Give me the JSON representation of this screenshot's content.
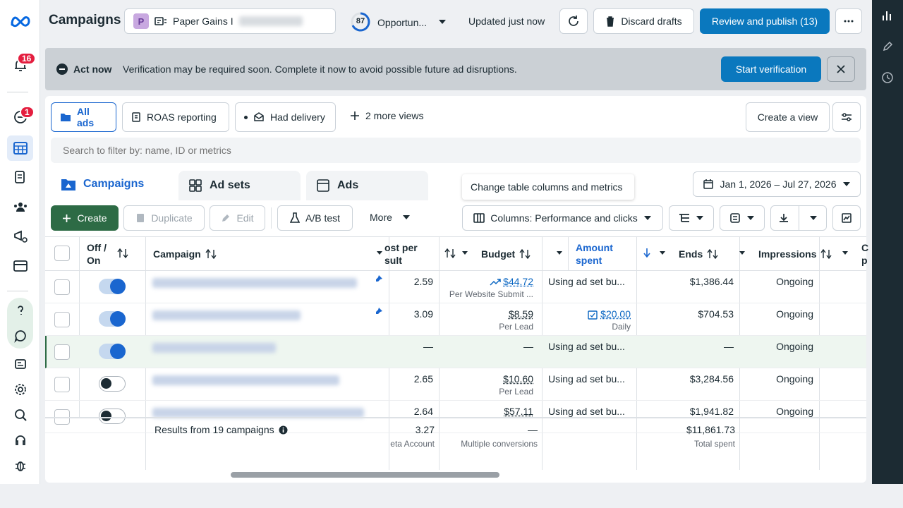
{
  "header": {
    "title": "Campaigns",
    "account_initial": "P",
    "account_name": "Paper Gains I",
    "opportunity_score": "87",
    "opportunity_label": "Opportun...",
    "updated": "Updated just now",
    "discard_label": "Discard drafts",
    "publish_label": "Review and publish (13)"
  },
  "nav": {
    "notifications_count": "16",
    "alerts_count": "1"
  },
  "banner": {
    "title": "Act now",
    "message": "Verification may be required soon. Complete it now to avoid possible future ad disruptions.",
    "button": "Start verification"
  },
  "views": {
    "all_ads": "All ads",
    "roas": "ROAS reporting",
    "had_delivery": "Had delivery",
    "more_views": "2 more views",
    "create_view": "Create a view"
  },
  "search": {
    "placeholder": "Search to filter by: name, ID or metrics"
  },
  "levels": {
    "campaigns": "Campaigns",
    "ad_sets": "Ad sets",
    "ads": "Ads"
  },
  "tooltip": "Change table columns and metrics",
  "date_range": "Jan 1, 2026 – Jul 27, 2026",
  "toolbar": {
    "create": "Create",
    "duplicate": "Duplicate",
    "edit": "Edit",
    "ab_test": "A/B test",
    "more": "More",
    "columns": "Columns: Performance and clicks"
  },
  "table": {
    "headers": {
      "off_on_1": "Off /",
      "off_on_2": "On",
      "campaign": "Campaign",
      "cost_1": "ost per",
      "cost_2": "sult",
      "budget": "Budget",
      "amount_1": "Amount",
      "amount_2": "spent",
      "ends": "Ends",
      "impressions": "Impressions",
      "next_1": "C",
      "next_2": "p"
    },
    "rows": [
      {
        "on": true,
        "cost": "2.59",
        "budget": "$44.72",
        "budget_sub": "Per Website Submit ...",
        "budget_trend": true,
        "amount": "Using ad set bu...",
        "ends_value": "$1,386.44",
        "impressions": "Ongoing",
        "pinned": true
      },
      {
        "on": true,
        "cost": "3.09",
        "budget": "$8.59",
        "budget_sub": "Per Lead",
        "amount": "$20.00",
        "amount_sub": "Daily",
        "amount_link": true,
        "ends_value": "$704.53",
        "impressions": "Ongoing",
        "pinned": true
      },
      {
        "on": true,
        "cost": "—",
        "budget": "—",
        "budget_sub": "",
        "amount": "Using ad set bu...",
        "ends_value": "—",
        "impressions": "Ongoing"
      },
      {
        "on": false,
        "cost": "2.65",
        "budget": "$10.60",
        "budget_sub": "Per Lead",
        "amount": "Using ad set bu...",
        "ends_value": "$3,284.56",
        "impressions": "Ongoing"
      },
      {
        "on": false,
        "cost": "2.64",
        "budget": "$57.11",
        "budget_sub": "",
        "amount": "Using ad set bu...",
        "ends_value": "$1,941.82",
        "impressions": "Ongoing"
      }
    ],
    "summary": {
      "label": "Results from 19 campaigns",
      "cost": "3.27",
      "cost_sub": "eta Account",
      "budget": "—",
      "budget_sub": "Multiple conversions",
      "total": "$11,861.73",
      "total_sub": "Total spent"
    }
  }
}
